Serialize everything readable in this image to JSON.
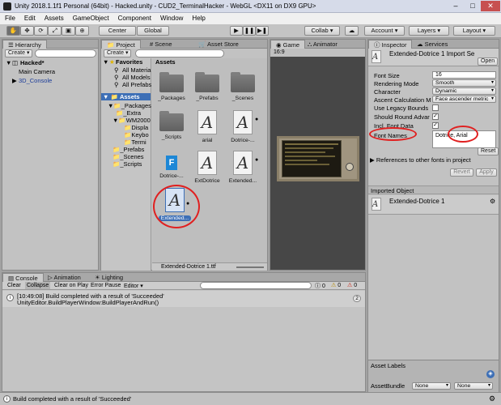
{
  "window": {
    "title": "Unity 2018.1.1f1 Personal (64bit) - Hacked.unity - CUD2_TerminalHacker - WebGL <DX11 on DX9 GPU>"
  },
  "menu": [
    "File",
    "Edit",
    "Assets",
    "GameObject",
    "Component",
    "Window",
    "Help"
  ],
  "toolbar": {
    "center": "Center",
    "global": "Global",
    "collab": "Collab",
    "account": "Account",
    "layers": "Layers",
    "layout": "Layout"
  },
  "hierarchy": {
    "tab": "Hierarchy",
    "create": "Create",
    "scene": "Hacked*",
    "items": [
      "Main Camera",
      "3D_Console"
    ]
  },
  "project": {
    "tabs": [
      "Project",
      "Scene",
      "Asset Store"
    ],
    "create": "Create",
    "favorites_label": "Favorites",
    "favorites": [
      "All Materia",
      "All Models",
      "All Prefabs"
    ],
    "assets_label": "Assets",
    "tree": [
      "_Packages",
      "_Extra",
      "WM2000",
      "Displa",
      "Keybo",
      "Termi",
      "_Prefabs",
      "_Scenes",
      "_Scripts"
    ],
    "breadcrumb": "Assets",
    "grid": [
      {
        "name": "_Packages",
        "type": "folder"
      },
      {
        "name": "_Prefabs",
        "type": "folder"
      },
      {
        "name": "_Scenes",
        "type": "folder"
      },
      {
        "name": "_Scripts",
        "type": "folder"
      },
      {
        "name": "arial",
        "type": "font"
      },
      {
        "name": "Dotrice-...",
        "type": "font"
      },
      {
        "name": "Dotrice-...",
        "type": "script"
      },
      {
        "name": "ExtDotrice",
        "type": "font"
      },
      {
        "name": "Extended...",
        "type": "font"
      },
      {
        "name": "Extended...",
        "type": "font"
      }
    ],
    "selected_file": "Extended-Dotrice 1.ttf"
  },
  "game": {
    "tabs": [
      "Game",
      "Animator"
    ],
    "aspect": "16:9"
  },
  "inspector": {
    "tabs": [
      "Inspector",
      "Services"
    ],
    "header_title": "Extended-Dotrice 1 Import Se",
    "open_button": "Open",
    "rows": [
      {
        "label": "Font Size",
        "value": "16",
        "kind": "text"
      },
      {
        "label": "Rendering Mode",
        "value": "Smooth",
        "kind": "dropdown"
      },
      {
        "label": "Character",
        "value": "Dynamic",
        "kind": "dropdown"
      },
      {
        "label": "Ascent Calculation M",
        "value": "Face ascender metric",
        "kind": "dropdown"
      },
      {
        "label": "Use Legacy Bounds",
        "value": "",
        "kind": "checkbox"
      },
      {
        "label": "Should Round Advar",
        "value": "✓",
        "kind": "checkbox"
      },
      {
        "label": "Incl. Font Data",
        "value": "✓",
        "kind": "checkbox"
      }
    ],
    "font_names_label": "Font Names",
    "font_names_value": "Dotrice, Arial",
    "reset": "Reset",
    "references_label": "References to other fonts in project",
    "revert": "Revert",
    "apply": "Apply",
    "imported_label": "Imported Object",
    "imported_name": "Extended-Dotrice 1",
    "asset_labels": "Asset Labels",
    "assetbundle_label": "AssetBundle",
    "none1": "None",
    "none2": "None"
  },
  "console": {
    "tabs": [
      "Console",
      "Animation",
      "Lighting"
    ],
    "buttons": [
      "Clear",
      "Collapse",
      "Clear on Play",
      "Error Pause",
      "Editor"
    ],
    "counts": [
      "0",
      "0",
      "0"
    ],
    "log_line1": "[10:49:08] Build completed with a result of 'Succeeded'",
    "log_line2": "UnityEditor.BuildPlayerWindow:BuildPlayerAndRun()",
    "log_count": "2"
  },
  "status": "Build completed with a result of 'Succeeded'",
  "colors": {
    "highlight": "#e02020",
    "selection": "#3d6fb6"
  }
}
